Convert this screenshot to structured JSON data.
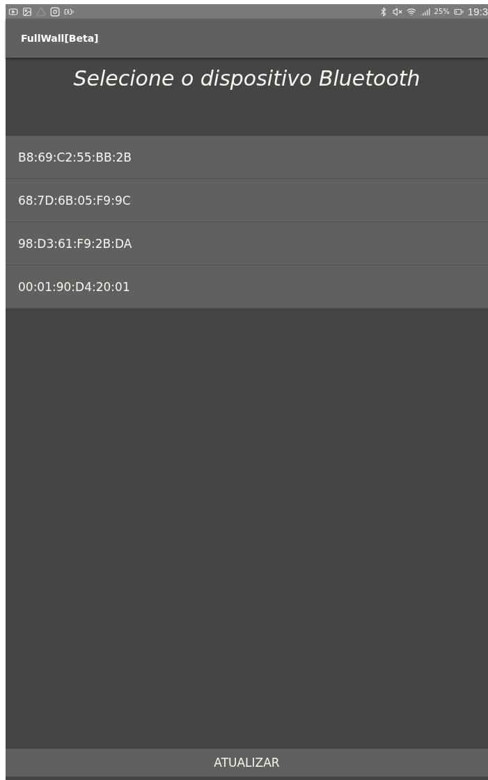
{
  "status_bar": {
    "battery": "25%",
    "time": "19:3"
  },
  "app_bar": {
    "title": "FullWall[Beta]"
  },
  "heading": "Selecione o dispositivo Bluetooth",
  "devices": [
    {
      "address": "B8:69:C2:55:BB:2B"
    },
    {
      "address": "68:7D:6B:05:F9:9C"
    },
    {
      "address": "98:D3:61:F9:2B:DA"
    },
    {
      "address": "00:01:90:D4:20:01"
    }
  ],
  "button": "ATUALIZAR"
}
